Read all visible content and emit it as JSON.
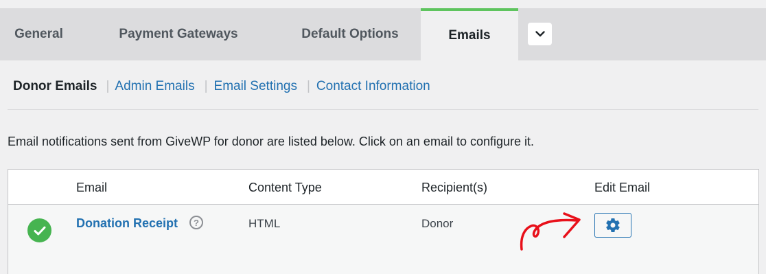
{
  "tabs": {
    "general": "General",
    "payment_gateways": "Payment Gateways",
    "default_options": "Default Options",
    "emails": "Emails",
    "more_icon": "chevron-down-icon",
    "active_color": "#5ec45e"
  },
  "subnav": {
    "donor_emails": "Donor Emails",
    "admin_emails": "Admin Emails",
    "email_settings": "Email Settings",
    "contact_information": "Contact Information",
    "separator": "|"
  },
  "intro_text": "Email notifications sent from GiveWP for donor are listed below. Click on an email to configure it.",
  "table": {
    "headers": {
      "email": "Email",
      "content_type": "Content Type",
      "recipients": "Recipient(s)",
      "edit_email": "Edit Email"
    },
    "rows": [
      {
        "status_icon": "check-circle-icon",
        "status_color": "#46b450",
        "email": "Donation Receipt",
        "help_icon": "question-circle-icon",
        "help_glyph": "?",
        "content_type": "HTML",
        "recipients": "Donor",
        "edit_icon": "gear-icon"
      }
    ]
  },
  "annotation": {
    "icon": "red-arrow-icon",
    "color": "#e8101a"
  },
  "colors": {
    "link": "#2271b1",
    "tabbar_bg": "#dcdcde",
    "page_bg": "#f0f0f1"
  }
}
